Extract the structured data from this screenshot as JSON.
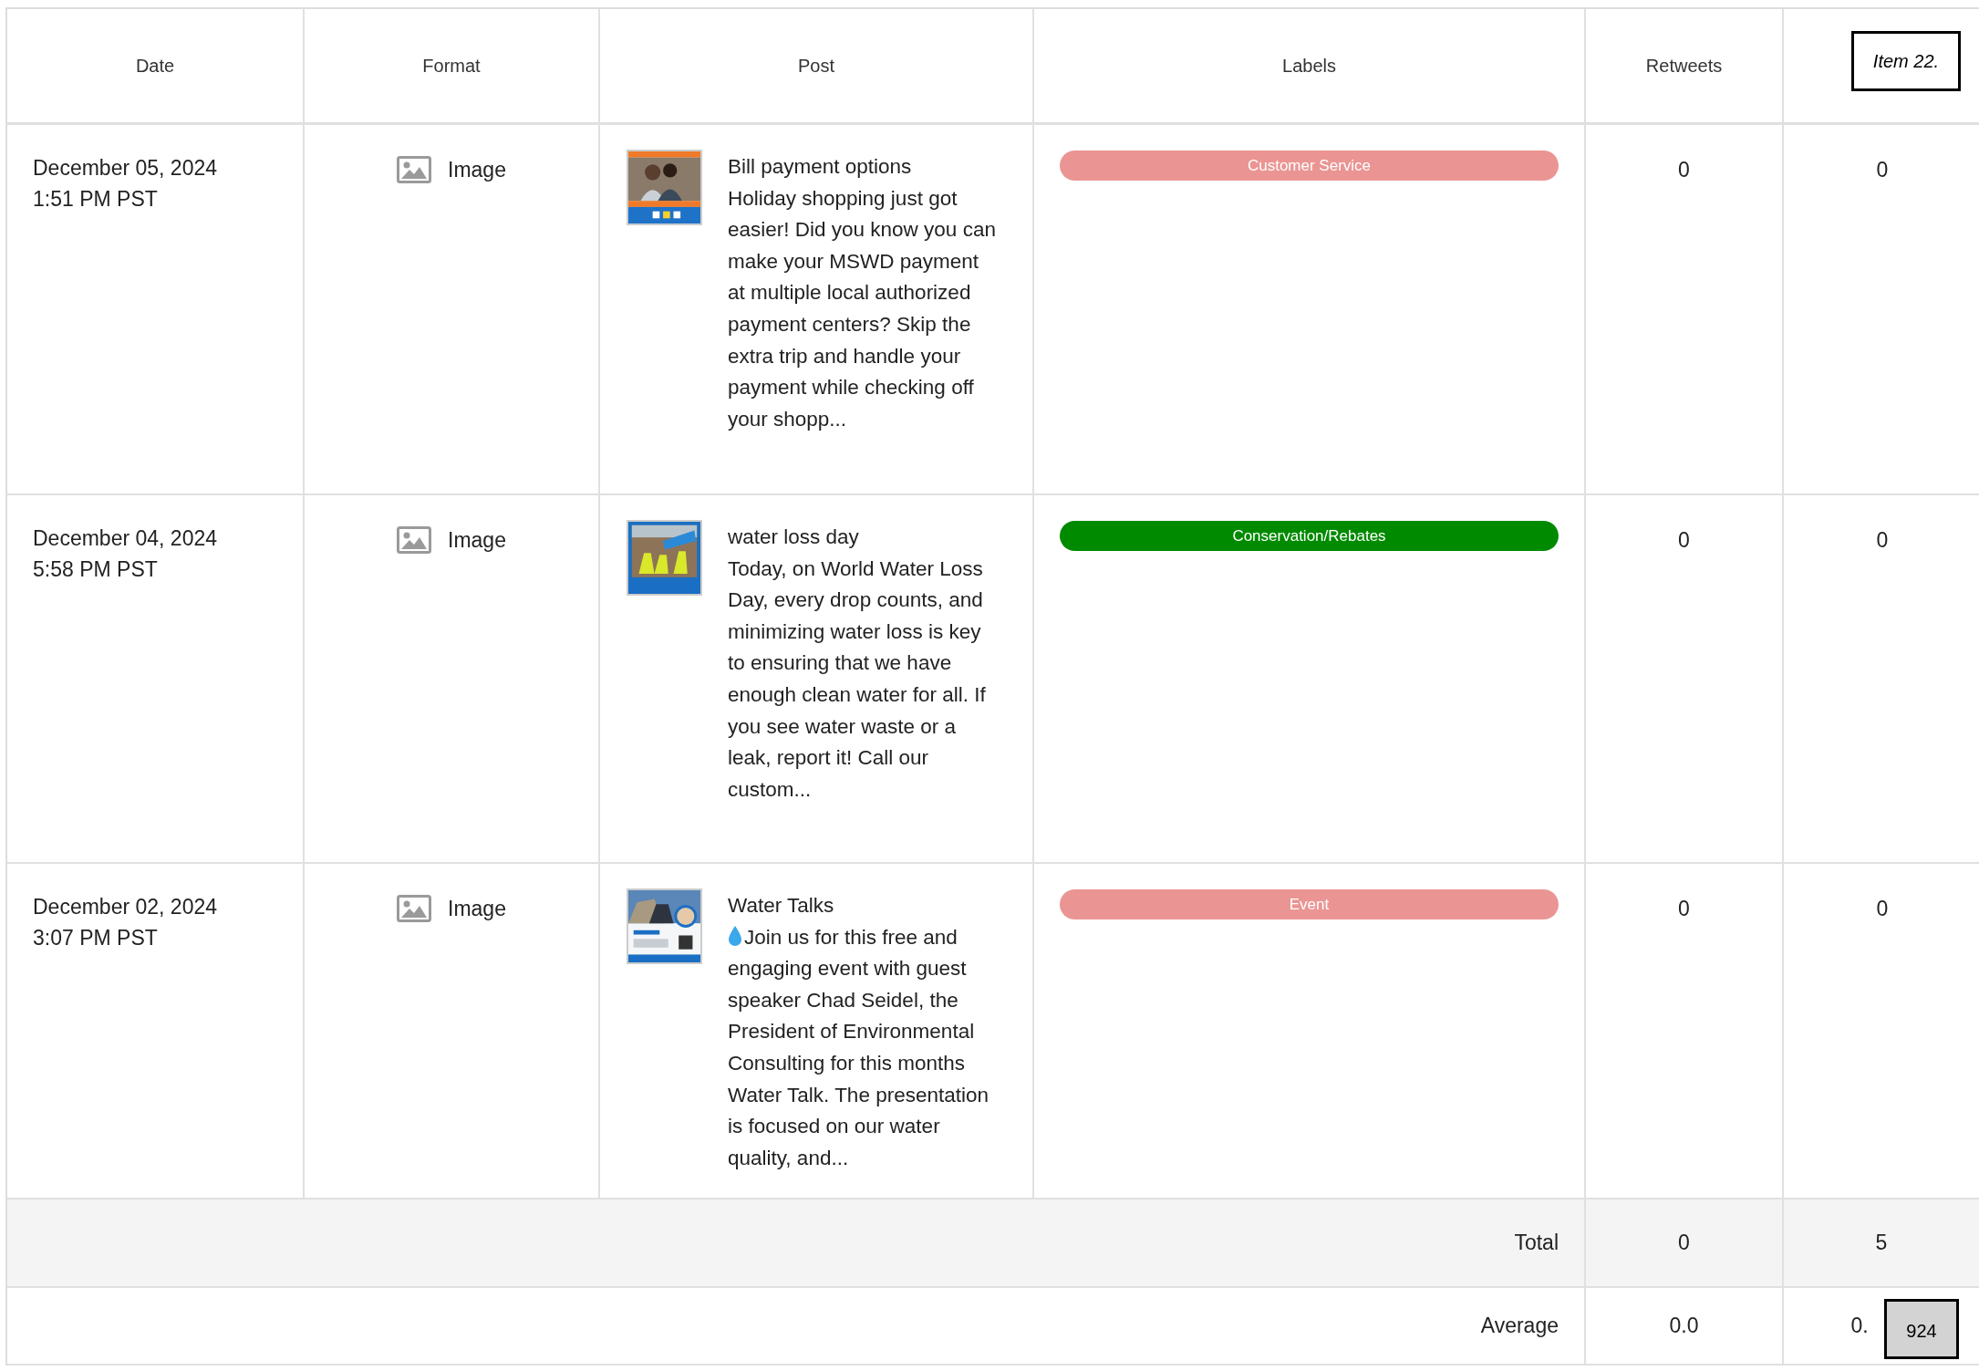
{
  "columns": [
    {
      "label": "Date"
    },
    {
      "label": "Format"
    },
    {
      "label": "Post"
    },
    {
      "label": "Labels"
    },
    {
      "label": "Retweets"
    }
  ],
  "header_overlay": "Item 22.",
  "rows": [
    {
      "date": "December 05, 2024",
      "time": "1:51 PM PST",
      "format": "Image",
      "post_title": "Bill payment options",
      "body_icon": false,
      "post_body": "Holiday shopping just got easier! Did you know you can make your MSWD payment at multiple local authorized payment centers? Skip the extra trip and handle your payment while checking off your shopp...",
      "label": {
        "text": "Customer Service",
        "color": "#ea9593"
      },
      "retweets": "0",
      "column_6": "0"
    },
    {
      "date": "December 04, 2024",
      "time": "5:58 PM PST",
      "format": "Image",
      "post_title": "water loss day",
      "body_icon": false,
      "post_body": "Today, on World Water Loss Day, every drop counts, and minimizing water loss is key to ensuring that we have enough clean water for all. If you see water waste or a leak, report it! Call our custom...",
      "label": {
        "text": "Conservation/Rebates",
        "color": "#008a00"
      },
      "retweets": "0",
      "column_6": "0"
    },
    {
      "date": "December 02, 2024",
      "time": "3:07 PM PST",
      "format": "Image",
      "post_title": "Water Talks",
      "body_icon": true,
      "post_body": "Join us for this free and engaging event with guest speaker Chad Seidel, the President of Environmental Consulting for this months Water Talk. The presentation is focused on our water quality, and...",
      "label": {
        "text": "Event",
        "color": "#ea9593"
      },
      "retweets": "0",
      "column_6": "0"
    }
  ],
  "total": {
    "label": "Total",
    "values": [
      "0",
      "5"
    ]
  },
  "average": {
    "label": "Average",
    "values": [
      "0.0",
      "0."
    ]
  },
  "overlay_badge": "924"
}
